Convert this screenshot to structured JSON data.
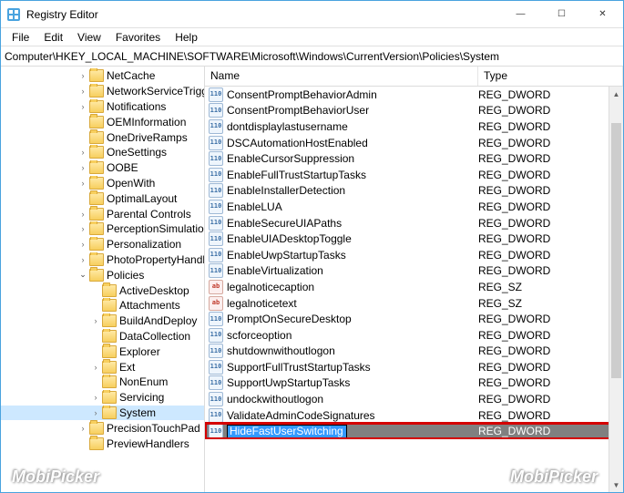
{
  "window": {
    "title": "Registry Editor",
    "min_glyph": "—",
    "max_glyph": "☐",
    "close_glyph": "✕"
  },
  "menu": {
    "items": [
      "File",
      "Edit",
      "View",
      "Favorites",
      "Help"
    ]
  },
  "address_path": "Computer\\HKEY_LOCAL_MACHINE\\SOFTWARE\\Microsoft\\Windows\\CurrentVersion\\Policies\\System",
  "tree": {
    "items": [
      {
        "label": "NetCache",
        "depth": 6,
        "exp": "closed"
      },
      {
        "label": "NetworkServiceTriggers",
        "depth": 6,
        "exp": "closed"
      },
      {
        "label": "Notifications",
        "depth": 6,
        "exp": "closed"
      },
      {
        "label": "OEMInformation",
        "depth": 6,
        "exp": "none"
      },
      {
        "label": "OneDriveRamps",
        "depth": 6,
        "exp": "none"
      },
      {
        "label": "OneSettings",
        "depth": 6,
        "exp": "closed"
      },
      {
        "label": "OOBE",
        "depth": 6,
        "exp": "closed"
      },
      {
        "label": "OpenWith",
        "depth": 6,
        "exp": "closed"
      },
      {
        "label": "OptimalLayout",
        "depth": 6,
        "exp": "none"
      },
      {
        "label": "Parental Controls",
        "depth": 6,
        "exp": "closed"
      },
      {
        "label": "PerceptionSimulation",
        "depth": 6,
        "exp": "closed"
      },
      {
        "label": "Personalization",
        "depth": 6,
        "exp": "closed"
      },
      {
        "label": "PhotoPropertyHandler",
        "depth": 6,
        "exp": "closed"
      },
      {
        "label": "Policies",
        "depth": 6,
        "exp": "open"
      },
      {
        "label": "ActiveDesktop",
        "depth": 7,
        "exp": "none"
      },
      {
        "label": "Attachments",
        "depth": 7,
        "exp": "none"
      },
      {
        "label": "BuildAndDeploy",
        "depth": 7,
        "exp": "closed"
      },
      {
        "label": "DataCollection",
        "depth": 7,
        "exp": "none"
      },
      {
        "label": "Explorer",
        "depth": 7,
        "exp": "none"
      },
      {
        "label": "Ext",
        "depth": 7,
        "exp": "closed"
      },
      {
        "label": "NonEnum",
        "depth": 7,
        "exp": "none"
      },
      {
        "label": "Servicing",
        "depth": 7,
        "exp": "closed"
      },
      {
        "label": "System",
        "depth": 7,
        "exp": "closed",
        "selected": true
      },
      {
        "label": "PrecisionTouchPad",
        "depth": 6,
        "exp": "closed"
      },
      {
        "label": "PreviewHandlers",
        "depth": 6,
        "exp": "none"
      }
    ]
  },
  "list": {
    "columns": {
      "name": "Name",
      "type": "Type"
    },
    "rows": [
      {
        "name": "ConsentPromptBehaviorAdmin",
        "type": "REG_DWORD",
        "icon": "dw"
      },
      {
        "name": "ConsentPromptBehaviorUser",
        "type": "REG_DWORD",
        "icon": "dw"
      },
      {
        "name": "dontdisplaylastusername",
        "type": "REG_DWORD",
        "icon": "dw"
      },
      {
        "name": "DSCAutomationHostEnabled",
        "type": "REG_DWORD",
        "icon": "dw"
      },
      {
        "name": "EnableCursorSuppression",
        "type": "REG_DWORD",
        "icon": "dw"
      },
      {
        "name": "EnableFullTrustStartupTasks",
        "type": "REG_DWORD",
        "icon": "dw"
      },
      {
        "name": "EnableInstallerDetection",
        "type": "REG_DWORD",
        "icon": "dw"
      },
      {
        "name": "EnableLUA",
        "type": "REG_DWORD",
        "icon": "dw"
      },
      {
        "name": "EnableSecureUIAPaths",
        "type": "REG_DWORD",
        "icon": "dw"
      },
      {
        "name": "EnableUIADesktopToggle",
        "type": "REG_DWORD",
        "icon": "dw"
      },
      {
        "name": "EnableUwpStartupTasks",
        "type": "REG_DWORD",
        "icon": "dw"
      },
      {
        "name": "EnableVirtualization",
        "type": "REG_DWORD",
        "icon": "dw"
      },
      {
        "name": "legalnoticecaption",
        "type": "REG_SZ",
        "icon": "sz"
      },
      {
        "name": "legalnoticetext",
        "type": "REG_SZ",
        "icon": "sz"
      },
      {
        "name": "PromptOnSecureDesktop",
        "type": "REG_DWORD",
        "icon": "dw"
      },
      {
        "name": "scforceoption",
        "type": "REG_DWORD",
        "icon": "dw"
      },
      {
        "name": "shutdownwithoutlogon",
        "type": "REG_DWORD",
        "icon": "dw"
      },
      {
        "name": "SupportFullTrustStartupTasks",
        "type": "REG_DWORD",
        "icon": "dw"
      },
      {
        "name": "SupportUwpStartupTasks",
        "type": "REG_DWORD",
        "icon": "dw"
      },
      {
        "name": "undockwithoutlogon",
        "type": "REG_DWORD",
        "icon": "dw"
      },
      {
        "name": "ValidateAdminCodeSignatures",
        "type": "REG_DWORD",
        "icon": "dw"
      },
      {
        "name": "HideFastUserSwitching",
        "type": "REG_DWORD",
        "icon": "dw",
        "editing": true,
        "highlight": true
      }
    ]
  },
  "icon_glyphs": {
    "dw": "011\n110",
    "sz": "ab"
  },
  "watermark": "MobiPicker"
}
